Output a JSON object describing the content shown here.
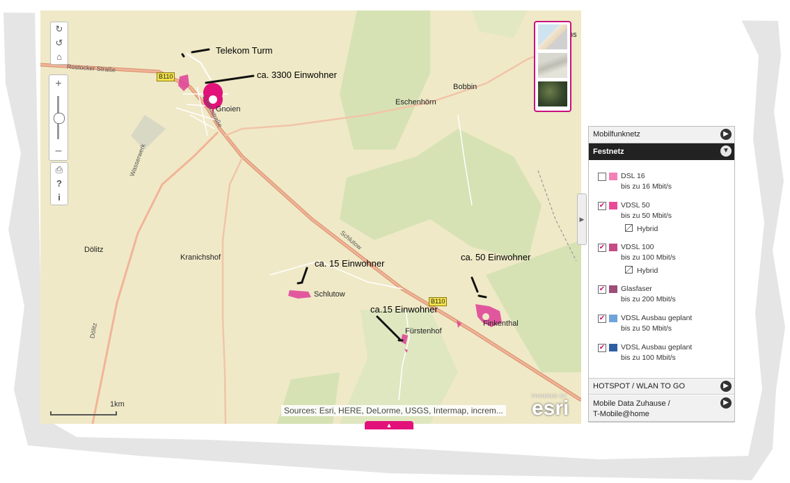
{
  "map": {
    "places": {
      "bobbin": "Bobbin",
      "eschenhoern": "Eschenhörn",
      "doelitz": "Dölitz",
      "kranichshof": "Kranichshof",
      "schlutow": "Schlutow",
      "fuerstenhof": "Fürstenhof",
      "finkenthal": "Finkenthal",
      "gnoien": "Gnoien",
      "edge_label": "hs"
    },
    "roads": {
      "rostocker": "Rostocker Straße",
      "wasserwerk": "Wasserwerk",
      "doelitz_road": "Dölitz",
      "schlutow_road": "Schlutow",
      "ladenstrasse": "Ludenstraße",
      "b110_a": "B110",
      "b110_b": "B110"
    },
    "annotations": {
      "telekom": "Telekom Turm",
      "pop_3300": "ca. 3300 Einwohner",
      "pop_15_a": "ca. 15 Einwohner",
      "pop_15_b": "ca.15 Einwohner",
      "pop_50": "ca. 50 Einwohner"
    },
    "scale_label": "1km",
    "attribution": "Sources: Esri, HERE, DeLorme, USGS, Intermap, increm...",
    "esri_powered": "POWERED BY",
    "esri_logo": "esri",
    "colors": {
      "accent": "#c8117c",
      "coverage": "#e0489a",
      "land": "#efe9c7",
      "forest": "#d6e2b4",
      "road": "#e8a07a"
    }
  },
  "panel": {
    "mobilfunk": "Mobilfunknetz",
    "festnetz": "Festnetz",
    "layers": [
      {
        "name": "DSL 16",
        "sub": "bis zu 16 Mbit/s",
        "checked": false,
        "color": "#f27fb8"
      },
      {
        "name": "VDSL 50",
        "sub": "bis zu 50 Mbit/s",
        "checked": true,
        "color": "#e94a98",
        "hybrid": "Hybrid"
      },
      {
        "name": "VDSL 100",
        "sub": "bis zu 100 Mbit/s",
        "checked": true,
        "color": "#c54a86",
        "hybrid": "Hybrid"
      },
      {
        "name": "Glasfaser",
        "sub": "bis zu 200 Mbit/s",
        "checked": true,
        "color": "#9c4d78"
      },
      {
        "name": "VDSL Ausbau geplant",
        "sub": "bis zu 50 Mbit/s",
        "checked": true,
        "color": "#6fa3d9"
      },
      {
        "name": "VDSL Ausbau geplant",
        "sub": "bis zu 100 Mbit/s",
        "checked": true,
        "color": "#2e5fa3"
      }
    ],
    "hotspot": "HOTSPOT / WLAN TO GO",
    "mobile_data_1": "Mobile Data Zuhause /",
    "mobile_data_2": "T-Mobile@home"
  }
}
